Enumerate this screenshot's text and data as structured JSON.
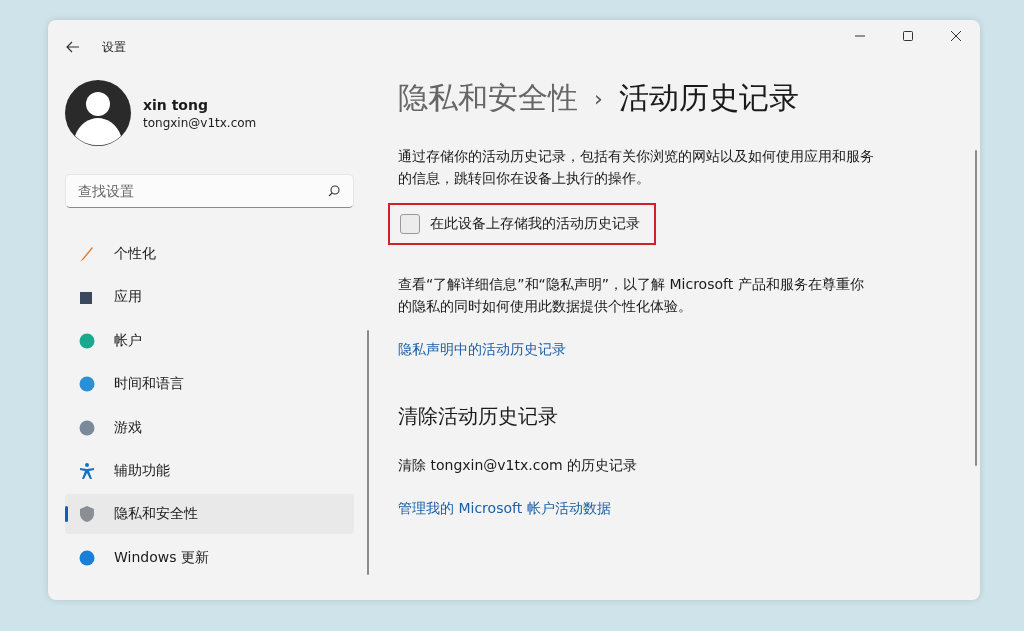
{
  "window": {
    "title": "设置"
  },
  "user": {
    "name": "xin tong",
    "email": "tongxin@v1tx.com"
  },
  "search": {
    "placeholder": "查找设置"
  },
  "sidebar": {
    "items": [
      {
        "label": "个性化",
        "selected": false
      },
      {
        "label": "应用",
        "selected": false
      },
      {
        "label": "帐户",
        "selected": false
      },
      {
        "label": "时间和语言",
        "selected": false
      },
      {
        "label": "游戏",
        "selected": false
      },
      {
        "label": "辅助功能",
        "selected": false
      },
      {
        "label": "隐私和安全性",
        "selected": true
      },
      {
        "label": "Windows 更新",
        "selected": false
      }
    ]
  },
  "breadcrumb": {
    "parent": "隐私和安全性",
    "separator": "›",
    "current": "活动历史记录"
  },
  "description": "通过存储你的活动历史记录，包括有关你浏览的网站以及如何使用应用和服务的信息，跳转回你在设备上执行的操作。",
  "store_option": {
    "label": "在此设备上存储我的活动历史记录",
    "checked": false,
    "highlighted": true
  },
  "info": "查看“了解详细信息”和“隐私声明”，以了解 Microsoft 产品和服务在尊重你的隐私的同时如何使用此数据提供个性化体验。",
  "privacy_link": "隐私声明中的活动历史记录",
  "clear_section": {
    "heading": "清除活动历史记录",
    "text": "清除 tongxin@v1tx.com 的历史记录",
    "link": "管理我的 Microsoft 帐户活动数据"
  }
}
